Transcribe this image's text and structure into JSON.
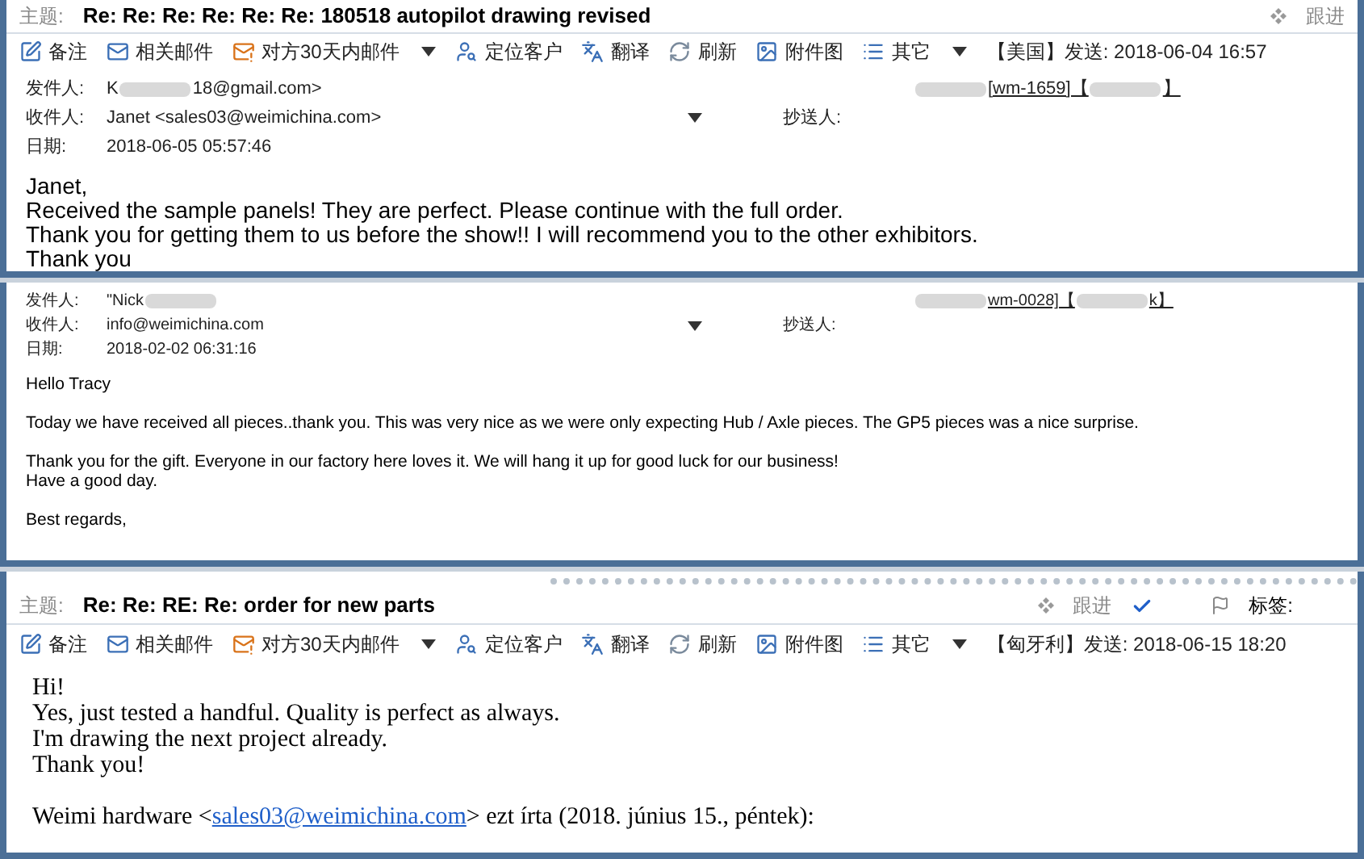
{
  "panels": [
    {
      "subject": {
        "label": "主题:",
        "text": "Re: Re: Re: Re: Re: Re: 180518 autopilot drawing revised",
        "follow": "跟进"
      },
      "toolbar": {
        "items": [
          {
            "label": "备注",
            "menu": false
          },
          {
            "label": "相关邮件",
            "menu": false
          },
          {
            "label": "对方30天内邮件",
            "menu": true
          },
          {
            "label": "定位客户",
            "menu": false
          },
          {
            "label": "翻译",
            "menu": false
          },
          {
            "label": "刷新",
            "menu": false
          },
          {
            "label": "附件图",
            "menu": false
          },
          {
            "label": "其它",
            "menu": true
          }
        ],
        "sent": "【美国】发送: 2018-06-04 16:57"
      },
      "headers": {
        "from": {
          "label": "发件人:",
          "value": [
            {
              "kind": "text",
              "text": "K"
            },
            {
              "kind": "redacted"
            },
            {
              "kind": "text",
              "text": "18@gmail.com>"
            }
          ],
          "contact": [
            {
              "kind": "redacted"
            },
            {
              "kind": "text",
              "text": "[wm-1659]【"
            },
            {
              "kind": "redacted"
            },
            {
              "kind": "text",
              "text": "】"
            }
          ]
        },
        "to": {
          "label": "收件人:",
          "value": "Janet <sales03@weimichina.com>"
        },
        "cc": {
          "label": "抄送人:"
        },
        "date": {
          "label": "日期:",
          "value": "2018-06-05 05:57:46"
        }
      },
      "body": {
        "paragraphs": [
          [
            "Janet,",
            "Received the sample panels!  They are perfect.  Please continue with the full order.",
            "Thank you for getting them to us before the show!!  I will recommend you to the other exhibitors.",
            "Thank you"
          ]
        ]
      }
    },
    {
      "headers": {
        "from": {
          "label": "发件人:",
          "value": [
            {
              "kind": "text",
              "text": "\"Nick"
            },
            {
              "kind": "redacted"
            }
          ],
          "contact": [
            {
              "kind": "redacted"
            },
            {
              "kind": "text",
              "text": "wm-0028]【"
            },
            {
              "kind": "redacted"
            },
            {
              "kind": "text",
              "text": "k】"
            }
          ]
        },
        "to": {
          "label": "收件人:",
          "value": "info@weimichina.com"
        },
        "cc": {
          "label": "抄送人:"
        },
        "date": {
          "label": "日期:",
          "value": "2018-02-02 06:31:16"
        }
      },
      "body": {
        "paragraphs": [
          [
            "Hello Tracy"
          ],
          [
            "Today we have received all pieces..thank you.  This was very nice as we were only expecting Hub / Axle pieces.  The GP5 pieces was a nice surprise."
          ],
          [
            "Thank you for the gift.  Everyone in our factory here loves it.  We will hang it up for good luck for our business!",
            "Have a good day."
          ],
          [
            "Best regards,"
          ]
        ]
      }
    },
    {
      "subject": {
        "label": "主题:",
        "text": "Re: Re: RE: Re: order for new parts",
        "follow": "跟进",
        "tag": "标签:"
      },
      "toolbar": {
        "items": [
          {
            "label": "备注",
            "menu": false
          },
          {
            "label": "相关邮件",
            "menu": false
          },
          {
            "label": "对方30天内邮件",
            "menu": true
          },
          {
            "label": "定位客户",
            "menu": false
          },
          {
            "label": "翻译",
            "menu": false
          },
          {
            "label": "刷新",
            "menu": false
          },
          {
            "label": "附件图",
            "menu": false
          },
          {
            "label": "其它",
            "menu": true
          }
        ],
        "sent": "【匈牙利】发送: 2018-06-15 18:20"
      },
      "body": {
        "paragraphs": [
          [
            "Hi!",
            "Yes, just tested a handful. Quality is perfect as always.",
            "I'm drawing the next project already.",
            "Thank you!"
          ],
          [
            {
              "before": "Weimi hardware <",
              "link": "sales03@weimichina.com",
              "after": "> ezt írta (2018. június 15., péntek):"
            }
          ]
        ]
      }
    }
  ]
}
